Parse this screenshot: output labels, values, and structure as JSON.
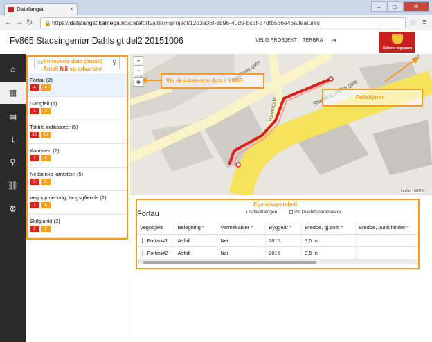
{
  "browser": {
    "tab_title": "Datafangst",
    "url_prefix": "https://",
    "url_host": "datafangst.kantega.no",
    "url_path": "/datafortvalter/#/project/12d3a36f-8b96-40d9-bc5f-57dfb536e46a/features",
    "win_min": "–",
    "win_max": "□",
    "win_close": "✕",
    "tab_close": "×"
  },
  "header": {
    "title": "Fv865 Stadsingeniør Dahls gt del2 20151006",
    "nav": [
      "VELG PROSJEKT",
      "TERBRA"
    ],
    "logout_icon": "logout-icon",
    "logo_text": "Statens vegvesen"
  },
  "sidebar": {
    "items": [
      {
        "icon": "home-icon",
        "glyph": "⌂"
      },
      {
        "icon": "grid-icon",
        "glyph": "▦"
      },
      {
        "icon": "document-icon",
        "glyph": "▤"
      },
      {
        "icon": "download-icon",
        "glyph": "⤓"
      },
      {
        "icon": "map-pin-icon",
        "glyph": "⚲"
      },
      {
        "icon": "link-icon",
        "glyph": "⛓"
      },
      {
        "icon": "gear-icon",
        "glyph": "⚙"
      }
    ]
  },
  "search": {
    "placeholder": "Søk",
    "icon": "search-icon"
  },
  "features": [
    {
      "name": "Fortau (2)",
      "errors": "4",
      "warnings": "4",
      "selected": true
    },
    {
      "name": "Gangfelt (1)",
      "errors": "1",
      "warnings": "2"
    },
    {
      "name": "Taktile indikatorer (5)",
      "errors": "10",
      "warnings": "10"
    },
    {
      "name": "Kantstein (2)",
      "errors": "2",
      "warnings": "4"
    },
    {
      "name": "Nedsenka kantstein (5)",
      "errors": "5",
      "warnings": "5"
    },
    {
      "name": "Vegoppmerking, langsgående (2)",
      "errors": "2",
      "warnings": "4"
    },
    {
      "name": "Skiltpunkt (2)",
      "errors": "2",
      "warnings": "2"
    }
  ],
  "annotations": {
    "list_line1": "Innleverte data (antall)",
    "list_line2_a": "Antall",
    "list_line2_b": "feil",
    "list_line2_c": "og advarsler",
    "nvdb": "Vis eksisterende data i NVDB",
    "fullscreen": "Fullskjerm",
    "props": "Egenskapstabell"
  },
  "map": {
    "streets": [
      "Haldens gate",
      "Vonnegata",
      "Stadsing Dahls gate"
    ],
    "zoom_in": "+",
    "zoom_out": "−",
    "layers_icon": "layers-icon",
    "fullscreen_icon": "fullscreen-icon",
    "credit": "Leaflet | NVDB"
  },
  "properties": {
    "title": "Fortau",
    "datakatalog": "i datakatalogen",
    "quality_params": "Vis kvalitetsparametere",
    "columns": [
      "Vegobjekt",
      "Belegning",
      "Varmekabler",
      "Byggeår",
      "Bredde, gj.snitt",
      "Bredde, punkthinder"
    ],
    "required": [
      false,
      true,
      true,
      true,
      true,
      true
    ],
    "rows": [
      [
        "Fortau#1",
        "Asfalt",
        "Nei",
        "2015",
        "3,5 m",
        ""
      ],
      [
        "Fortau#2",
        "Asfalt",
        "Nei",
        "2015",
        "3,5 m",
        ""
      ]
    ]
  },
  "colors": {
    "accent_orange": "#f39c1f",
    "error_red": "#d8221b",
    "warning_orange": "#f1a31f",
    "road_yellow": "#f6e25b",
    "sidebar_dark": "#2b2b2b",
    "brand_red": "#c8201e"
  }
}
